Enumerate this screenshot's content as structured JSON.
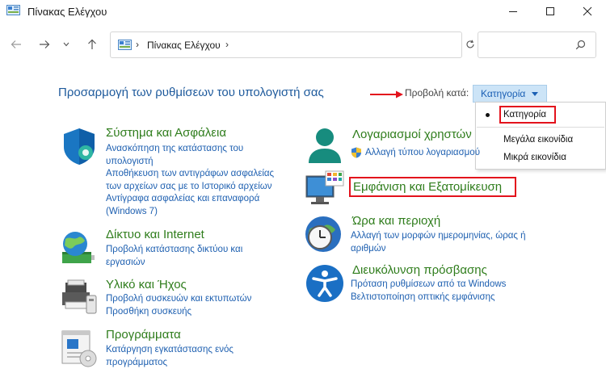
{
  "window": {
    "title": "Πίνακας Ελέγχου"
  },
  "address": {
    "crumb": "Πίνακας Ελέγχου"
  },
  "header": {
    "heading": "Προσαρμογή των ρυθμίσεων του υπολογιστή σας",
    "view_by_label": "Προβολή κατά:",
    "view_by_value": "Κατηγορία"
  },
  "view_menu": {
    "items": [
      "Κατηγορία",
      "Μεγάλα εικονίδια",
      "Μικρά εικονίδια"
    ],
    "selected": "Κατηγορία"
  },
  "categories": {
    "system": {
      "title": "Σύστημα και Ασφάλεια",
      "links": [
        "Ανασκόπηση της κατάστασης του",
        "υπολογιστή",
        "Αποθήκευση των αντιγράφων ασφαλείας",
        "των αρχείων σας με το Ιστορικό αρχείων",
        "Αντίγραφα ασφαλείας και επαναφορά",
        "(Windows 7)"
      ]
    },
    "network": {
      "title": "Δίκτυο και Internet",
      "links": [
        "Προβολή κατάστασης δικτύου και",
        "εργασιών"
      ]
    },
    "hardware": {
      "title": "Υλικό και Ήχος",
      "links": [
        "Προβολή συσκευών και εκτυπωτών",
        "Προσθήκη συσκευής"
      ]
    },
    "programs": {
      "title": "Προγράμματα",
      "links": [
        "Κατάργηση εγκατάστασης ενός",
        "προγράμματος"
      ]
    },
    "accounts": {
      "title": "Λογαριασμοί χρηστών",
      "links": [
        "Αλλαγή τύπου λογαριασμού"
      ]
    },
    "appearance": {
      "title": "Εμφάνιση και Εξατομίκευση"
    },
    "clock": {
      "title": "Ώρα και περιοχή",
      "links": [
        "Αλλαγή των μορφών ημερομηνίας, ώρας ή",
        "αριθμών"
      ]
    },
    "ease": {
      "title": "Διευκόλυνση πρόσβασης",
      "links": [
        "Πρόταση ρυθμίσεων από τα Windows",
        "Βελτιστοποίηση οπτικής εμφάνισης"
      ]
    }
  },
  "colors": {
    "link": "#1d5fb0",
    "category_title": "#2f7d1c",
    "heading": "#1e5a9c",
    "highlight": "#e3121c",
    "selected_bg": "#cce4f7"
  }
}
